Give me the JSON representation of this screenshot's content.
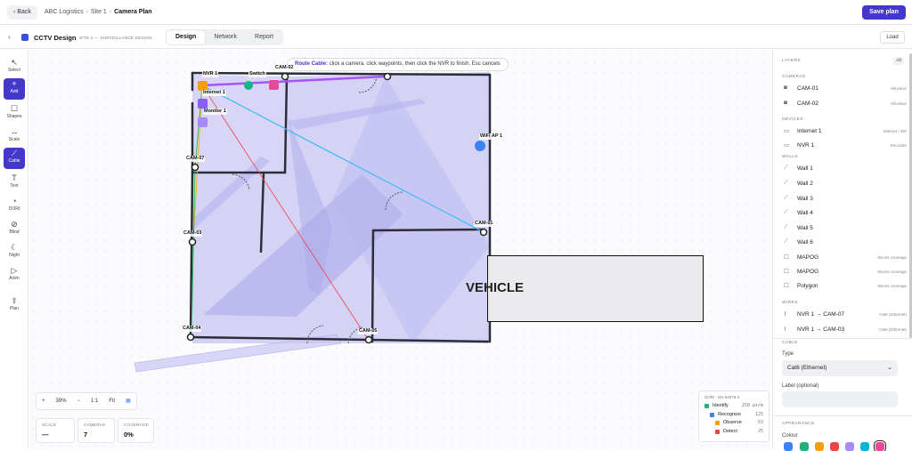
{
  "header": {
    "back_label": "‹ Back",
    "breadcrumb": [
      "ABC Logistics",
      "Site 1",
      "Camera Plan"
    ],
    "save_label": "Save plan"
  },
  "subheader": {
    "title": "CCTV Design",
    "subtitle": "SITE 1 — SURVEILLANCE DESIGN",
    "tabs": [
      "Design",
      "Network",
      "Report"
    ],
    "active_tab": "Design",
    "load_label": "Load"
  },
  "toolbar": [
    {
      "icon": "cursor-icon",
      "label": "Select"
    },
    {
      "icon": "plus-icon",
      "label": "Add"
    },
    {
      "icon": "square-icon",
      "label": "Shapes"
    },
    {
      "icon": "ruler-icon",
      "label": "Scale"
    },
    {
      "icon": "cable-icon",
      "label": "Cable"
    },
    {
      "icon": "text-icon",
      "label": "Text"
    },
    {
      "icon": "dori-icon",
      "label": "DORI"
    },
    {
      "icon": "blind-icon",
      "label": "Blind"
    },
    {
      "icon": "moon-icon",
      "label": "Night"
    },
    {
      "icon": "play-icon",
      "label": "Anim"
    },
    {
      "icon": "upload-icon",
      "label": "Plan"
    }
  ],
  "canvas": {
    "hint_bold": "Route Cable:",
    "hint_text": " click a camera, click waypoints, then click the NVR to finish. Esc cancels",
    "labels": {
      "nvr": "NVR 1",
      "switch": "Switch",
      "internet": "Internet 1",
      "monitor": "Monitor 1",
      "cam02": "CAM-02",
      "wifi": "WiFi AP 1",
      "cam07": "CAM-07",
      "cam03": "CAM-03",
      "cam01": "CAM-01",
      "cam04": "CAM-04",
      "cam05": "CAM-05",
      "vehicle": "VEHICLE"
    }
  },
  "zoom": {
    "minus_left": "+",
    "level": "39%",
    "minus": "−",
    "one_to_one": "1:1",
    "fit": "Fit"
  },
  "stats": [
    {
      "key": "SCALE",
      "value": "—"
    },
    {
      "key": "CAMERAS",
      "value": "7"
    },
    {
      "key": "COVERAGE",
      "value": "0%"
    }
  ],
  "dori": {
    "title": "DORI · EN 62676-4",
    "rows": [
      {
        "name": "Identify",
        "value": "250 px/m",
        "color": "#22b07d"
      },
      {
        "name": "Recognize",
        "value": "125",
        "color": "#3b82f6"
      },
      {
        "name": "Observe",
        "value": "63",
        "color": "#f59e0b"
      },
      {
        "name": "Detect",
        "value": "25",
        "color": "#ef4444"
      }
    ]
  },
  "panel": {
    "layers_title": "LAYERS",
    "all_label": "All",
    "cameras_title": "CAMERAS",
    "cameras": [
      {
        "name": "CAM-01",
        "sub": "Hikvision"
      },
      {
        "name": "CAM-02",
        "sub": "Hikvision"
      }
    ],
    "devices_title": "DEVICES",
    "devices": [
      {
        "name": "Internet 1",
        "sub": "Internet / ISP"
      },
      {
        "name": "NVR 1",
        "sub": "Recorder"
      }
    ],
    "walls_title": "WALLS",
    "walls": [
      "Wall 1",
      "Wall 2",
      "Wall 3",
      "Wall 4",
      "Wall 5",
      "Wall 6"
    ],
    "shapes": [
      {
        "name": "MAPOG",
        "sub": "blocks coverage"
      },
      {
        "name": "MAPOG",
        "sub": "blocks coverage"
      },
      {
        "name": "Polygon",
        "sub": "blocks coverage"
      }
    ],
    "wires_title": "WIRES",
    "wires": [
      {
        "name": "NVR 1 → CAM-07",
        "sub": "Cat6 (Ethernet)"
      },
      {
        "name": "NVR 1 → CAM-03",
        "sub": "Cat6 (Ethernet)"
      }
    ],
    "cable_title": "CABLE",
    "type_label": "Type",
    "type_value": "Cat6 (Ethernet)",
    "label_label": "Label (optional)",
    "appearance_title": "APPEARANCE",
    "colour_label": "Colour",
    "swatches": [
      "#3b82f6",
      "#22b07d",
      "#f59e0b",
      "#ef4444",
      "#a78bfa",
      "#06b6d4",
      "#ec4899"
    ]
  }
}
